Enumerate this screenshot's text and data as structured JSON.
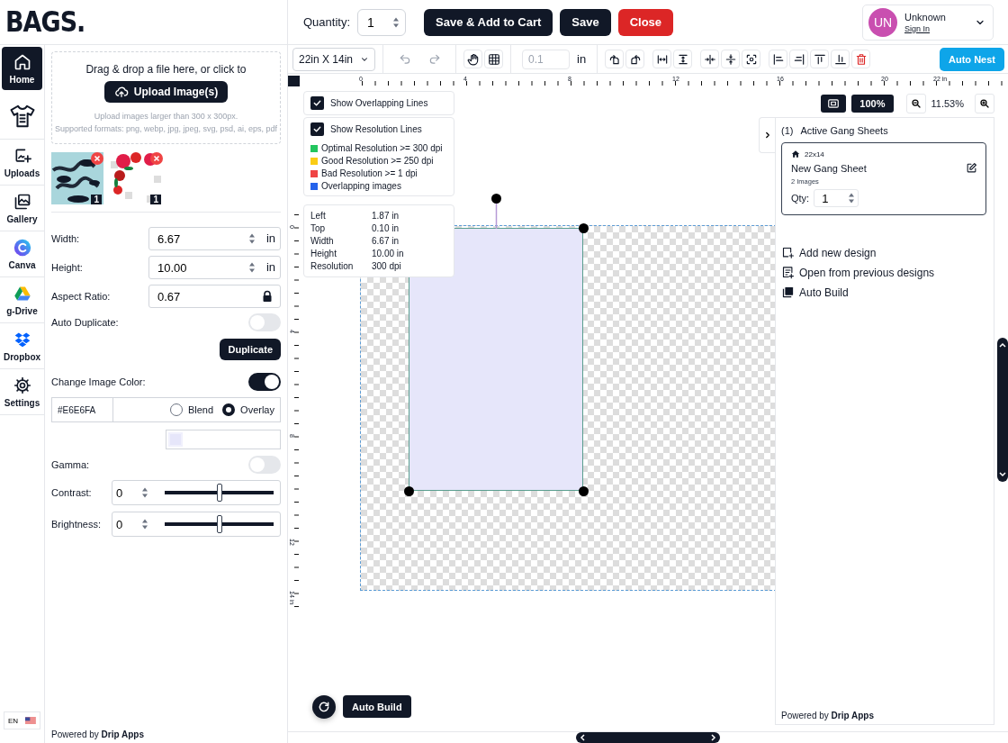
{
  "logo": {
    "text": "BAGS."
  },
  "header": {
    "quantity_label": "Quantity:",
    "quantity": "1",
    "buttons": [
      {
        "label": "Save & Add to Cart",
        "kind": "primary"
      },
      {
        "label": "Save",
        "kind": "primary"
      },
      {
        "label": "Close",
        "kind": "danger"
      }
    ],
    "user": {
      "initials": "UN",
      "name": "Unknown",
      "link": "Sign In"
    }
  },
  "nav": {
    "items": [
      {
        "label": "Home",
        "kind": "home",
        "selected": true
      },
      {
        "kind": "shirt",
        "selected": false
      },
      {
        "label": "Uploads",
        "kind": "uploads",
        "selected": false
      },
      {
        "label": "Gallery",
        "kind": "gallery",
        "selected": false
      },
      {
        "label": "Canva",
        "kind": "canva",
        "selected": false
      },
      {
        "label": "g-Drive",
        "kind": "drive",
        "selected": false
      },
      {
        "label": "Dropbox",
        "kind": "dropbox",
        "selected": false
      },
      {
        "label": "Settings",
        "kind": "settings",
        "selected": false
      }
    ],
    "language": "EN"
  },
  "upload": {
    "prompt": "Drag & drop a file here, or click to",
    "button": "Upload Image(s)",
    "hints": [
      "Upload images larger than 300 x 300px.",
      "Supported formats: png, webp, jpg, jpeg, svg, psd, ai, eps, pdf"
    ]
  },
  "images": [
    {
      "kind": "picture",
      "count": "1"
    },
    {
      "kind": "picture",
      "count": "1"
    }
  ],
  "properties": [
    {
      "label": "Width:",
      "value": "6.67",
      "unit": "in",
      "kind": "number"
    },
    {
      "label": "Height:",
      "value": "10.00",
      "unit": "in",
      "kind": "number"
    },
    {
      "label": "Aspect Ratio:",
      "value": "0.67",
      "kind": "locked"
    }
  ],
  "auto_duplicate": {
    "label": "Auto Duplicate:",
    "on": false
  },
  "duplicate_button": "Duplicate",
  "change_color": {
    "label": "Change Image Color:",
    "on": true,
    "value": "#E6E6FA",
    "modes": [
      {
        "label": "Blend",
        "selected": false
      },
      {
        "label": "Overlay",
        "selected": true
      }
    ]
  },
  "gamma": {
    "label": "Gamma:",
    "on": false
  },
  "adjustments": [
    {
      "label": "Contrast:",
      "value": "0",
      "level": 0.5
    },
    {
      "label": "Brightness:",
      "value": "0",
      "level": 0.5
    }
  ],
  "panel_footer": "Powered by **Drip Apps**",
  "toolbar": {
    "sheet_size": "22in X 14in",
    "tools": [
      {
        "kind": "undo",
        "disabled": true
      },
      {
        "kind": "redo",
        "disabled": true
      },
      {
        "kind": "pan",
        "disabled": false
      },
      {
        "kind": "grid",
        "disabled": false
      },
      {
        "kind": "rotate-left",
        "disabled": false
      },
      {
        "kind": "rotate-right",
        "disabled": false
      },
      {
        "kind": "fit-width",
        "disabled": false
      },
      {
        "kind": "fit-height",
        "disabled": false
      },
      {
        "kind": "center-horizontal",
        "disabled": false
      },
      {
        "kind": "center-vertical",
        "disabled": false
      },
      {
        "kind": "focus",
        "disabled": false
      },
      {
        "kind": "align-left",
        "disabled": false
      },
      {
        "kind": "align-right",
        "disabled": false
      },
      {
        "kind": "align-top",
        "disabled": false
      },
      {
        "kind": "align-bottom",
        "disabled": false
      },
      {
        "kind": "delete",
        "disabled": false
      }
    ],
    "spacing_placeholder": "0.1",
    "spacing_unit": "in",
    "auto_nest": "Auto Nest"
  },
  "rulers": {
    "horizontal": [
      "0",
      "4",
      "8",
      "12",
      "16",
      "20",
      "22 in"
    ],
    "vertical": [
      "0",
      "4",
      "8",
      "12",
      "14 in"
    ]
  },
  "canvas_options": [
    {
      "label": "Show Overlapping Lines",
      "checked": true
    },
    {
      "label": "Show Resolution Lines",
      "checked": true
    }
  ],
  "legend": [
    {
      "label": "Optimal Resolution >= 300 dpi",
      "color": "#22c55e"
    },
    {
      "label": "Good Resolution >= 250 dpi",
      "color": "#facc15"
    },
    {
      "label": "Bad Resolution >= 1 dpi",
      "color": "#ef4444"
    },
    {
      "label": "Overlapping images",
      "color": "#2563eb"
    }
  ],
  "selection": [
    {
      "label": "Left",
      "value": "1.87 in"
    },
    {
      "label": "Top",
      "value": "0.10 in"
    },
    {
      "label": "Width",
      "value": "6.67 in"
    },
    {
      "label": "Height",
      "value": "10.00 in"
    },
    {
      "label": "Resolution",
      "value": "300 dpi"
    }
  ],
  "zoom": {
    "reset": "100%",
    "percent": "11.53%"
  },
  "gang_sheets": {
    "count": "(1)",
    "title": "Active Gang Sheets",
    "sheets": [
      {
        "size": "22x14",
        "name": "New Gang Sheet",
        "images": "2 Images",
        "qty_label": "Qty:",
        "qty": "1"
      }
    ],
    "actions": [
      {
        "label": "Add new design",
        "kind": "add"
      },
      {
        "label": "Open from previous designs",
        "kind": "open"
      },
      {
        "label": "Auto Build",
        "kind": "build"
      }
    ],
    "footer": "Powered by **Drip Apps**"
  },
  "auto_build": "Auto Build"
}
